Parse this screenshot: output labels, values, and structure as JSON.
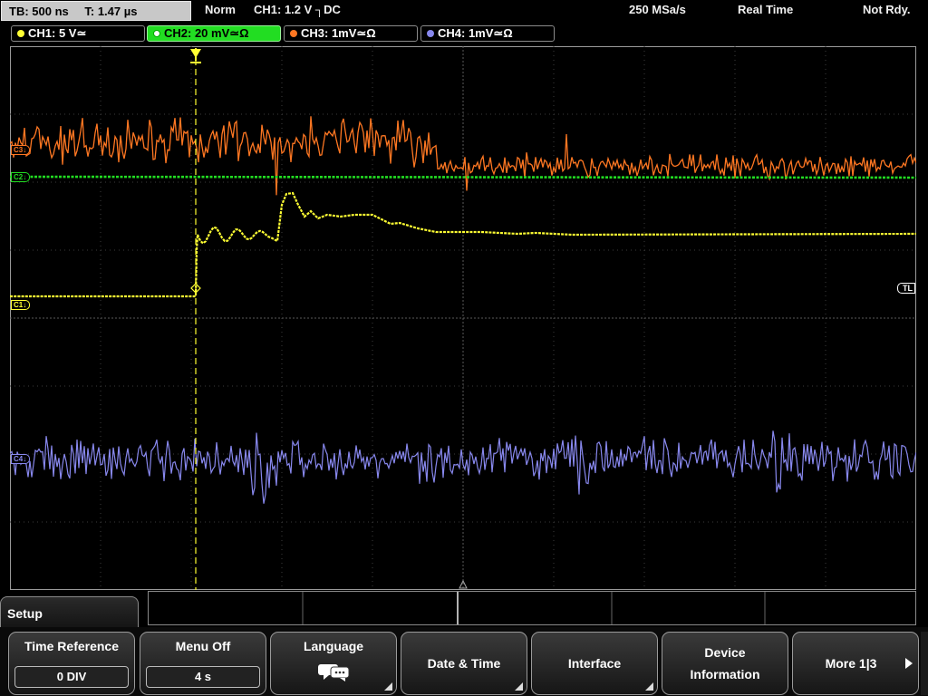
{
  "status_bar": {
    "timebase": "TB: 500 ns",
    "trigger_time": "T: 1.47 µs",
    "trigger_mode": "Norm",
    "trigger_source": "CH1: 1.2 V ┐DC",
    "sample_rate": "250 MSa/s",
    "acquisition_mode": "Real Time",
    "ready_state": "Not Rdy."
  },
  "channels": [
    {
      "label": "CH1: 5 V≃",
      "color": "#ffff33",
      "active": false
    },
    {
      "label": "CH2: 20 mV≃Ω",
      "color": "#22dd22",
      "active": true
    },
    {
      "label": "CH3: 1mV≃Ω",
      "color": "#ff7722",
      "active": false
    },
    {
      "label": "CH4: 1mV≃Ω",
      "color": "#8888ee",
      "active": false
    }
  ],
  "channel_markers": {
    "ch1": "C1↓",
    "ch2": "C2↓",
    "ch3": "C3↓",
    "ch4": "C4↓"
  },
  "trigger_level_marker": "TL",
  "setup_menu": {
    "title": "Setup"
  },
  "softkeys": [
    {
      "label": "Time Reference",
      "value": "0 DIV"
    },
    {
      "label": "Menu Off",
      "value": "4 s"
    },
    {
      "label": "Language",
      "icon": "speech-bubbles-icon"
    },
    {
      "label": "Date & Time"
    },
    {
      "label": "Interface"
    },
    {
      "label_line1": "Device",
      "label_line2": "Information"
    },
    {
      "label": "More 1|3"
    }
  ],
  "colors": {
    "ch1": "#ffff33",
    "ch2": "#22dd22",
    "ch3": "#ff7722",
    "ch4": "#8888ee",
    "grid": "#8a8a8a"
  }
}
